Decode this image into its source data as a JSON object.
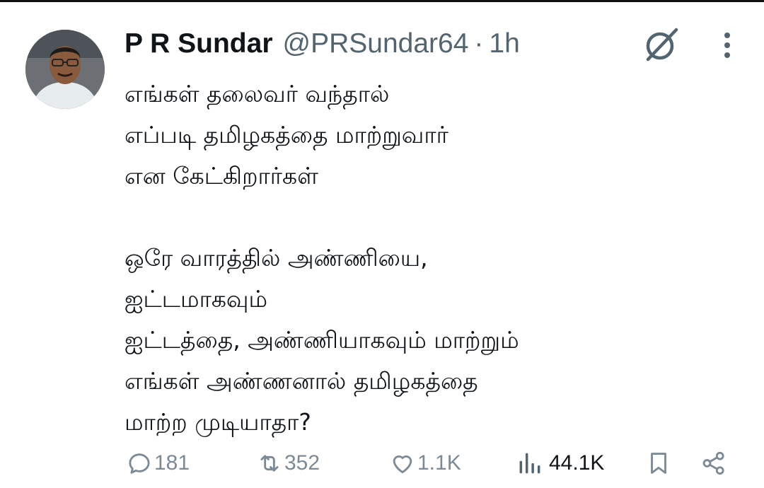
{
  "tweet": {
    "author_name": "P R Sundar",
    "handle": "@PRSundar64",
    "separator": "·",
    "time": "1h",
    "body": "எங்கள் தலைவர் வந்தால்\nஎப்படி தமிழகத்தை மாற்றுவார்\nஎன கேட்கிறார்கள்\n\nஒரே வாரத்தில் அண்ணியை,\nஐட்டமாகவும்\nஐட்டத்தை, அண்ணியாகவும் மாற்றும்\nஎங்கள் அண்ணனால் தமிழகத்தை\nமாற்ற முடியாதா?"
  },
  "actions": {
    "replies": "181",
    "reposts": "352",
    "likes": "1.1K",
    "views": "44.1K"
  },
  "icons": {
    "grok": "grok-icon",
    "more": "more-vertical-icon",
    "reply": "reply-icon",
    "repost": "repost-icon",
    "like": "heart-icon",
    "views": "views-icon",
    "bookmark": "bookmark-icon",
    "share": "share-icon"
  },
  "colors": {
    "text": "#0f1419",
    "muted": "#536471",
    "background": "#ffffff"
  }
}
